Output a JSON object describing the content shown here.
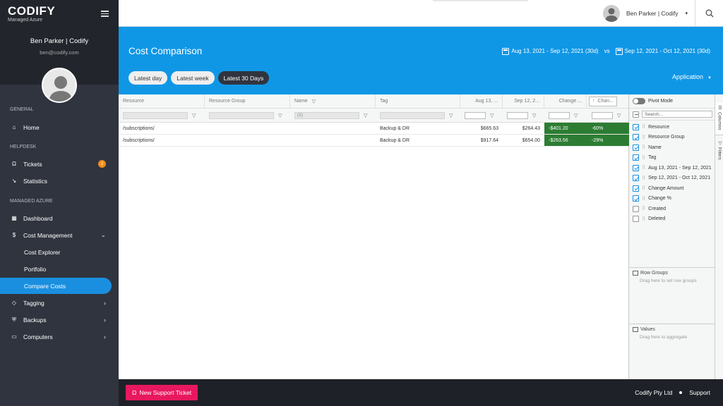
{
  "brand": {
    "name": "CODIFY",
    "sub": "Managed Azure"
  },
  "user": {
    "name": "Ben Parker | Codify",
    "email": "ben@codify.com"
  },
  "sidebar": {
    "sections": [
      "GENERAL",
      "HELPDESK",
      "MANAGED AZURE"
    ],
    "items": [
      {
        "label": "Home",
        "icon": "home-icon"
      },
      {
        "label": "Tickets",
        "icon": "headset-icon",
        "badge": "2"
      },
      {
        "label": "Statistics",
        "icon": "trend-icon"
      },
      {
        "label": "Dashboard",
        "icon": "dashboard-icon"
      },
      {
        "label": "Cost Management",
        "icon": "dollar-icon"
      },
      {
        "label": "Cost Explorer"
      },
      {
        "label": "Portfolio"
      },
      {
        "label": "Compare Costs"
      },
      {
        "label": "Tagging",
        "icon": "tag-icon"
      },
      {
        "label": "Backups",
        "icon": "shield-icon"
      },
      {
        "label": "Computers",
        "icon": "laptop-icon"
      }
    ]
  },
  "header": {
    "title": "Cost Comparison",
    "date1": "Aug 13, 2021 - Sep 12, 2021 (30d)",
    "vs": "vs",
    "date2": "Sep 12, 2021 - Oct 12, 2021 (30d)",
    "ranges": [
      "Latest day",
      "Latest week",
      "Latest 30 Days"
    ],
    "selected_range": "Latest 30 Days",
    "app_dropdown": "Application"
  },
  "grid": {
    "columns": [
      "Resource",
      "Resource Group",
      "Name",
      "Tag",
      "Aug 13, ...",
      "Sep 12, 2...",
      "Change ...",
      "Chan..."
    ],
    "name_filter": "(2)",
    "rows": [
      {
        "resource": "/subscriptions/",
        "tag": "Backup & DR",
        "prev": "$665.63",
        "curr": "$264.43",
        "change": "-$401.20",
        "pct": "-60%"
      },
      {
        "resource": "/subscriptions/",
        "tag": "Backup & DR",
        "prev": "$917.64",
        "curr": "$654.00",
        "change": "-$263.56",
        "pct": "-29%"
      }
    ]
  },
  "panel": {
    "pivot_label": "Pivot Mode",
    "search_placeholder": "Search...",
    "columns": [
      {
        "label": "Resource",
        "checked": true
      },
      {
        "label": "Resource Group",
        "checked": true
      },
      {
        "label": "Name",
        "checked": true
      },
      {
        "label": "Tag",
        "checked": true
      },
      {
        "label": "Aug 13, 2021 - Sep 12, 2021",
        "checked": true
      },
      {
        "label": "Sep 12, 2021 - Oct 12, 2021",
        "checked": true
      },
      {
        "label": "Change Amount",
        "checked": true
      },
      {
        "label": "Change %",
        "checked": true
      },
      {
        "label": "Created",
        "checked": false
      },
      {
        "label": "Deleted",
        "checked": false
      }
    ],
    "row_groups_title": "Row Groups",
    "row_groups_hint": "Drag here to set row groups",
    "values_title": "Values",
    "values_hint": "Drag here to aggregate",
    "tab_columns": "Columns",
    "tab_filters": "Filters"
  },
  "footer": {
    "ticket_label": "New Support Ticket",
    "company": "Codify Pty Ltd",
    "support": "Support"
  },
  "colors": {
    "primary": "#0f97e6",
    "sidebar": "#30343e",
    "negative": "#2c7d33",
    "ticket": "#e8185f",
    "badge": "#f08c1a"
  }
}
